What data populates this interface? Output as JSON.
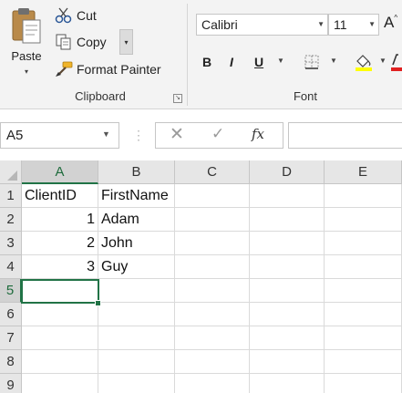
{
  "ribbon": {
    "clipboard": {
      "paste_label": "Paste",
      "cut_label": "Cut",
      "copy_label": "Copy",
      "format_painter_label": "Format Painter",
      "group_label": "Clipboard"
    },
    "font": {
      "font_name": "Calibri",
      "font_size": "11",
      "grow_font": "A",
      "bold": "B",
      "italic": "I",
      "underline": "U",
      "group_label": "Font"
    }
  },
  "formula_bar": {
    "name_box": "A5",
    "cancel_icon": "✕",
    "enter_icon": "✓",
    "function_label": "fx",
    "formula": ""
  },
  "grid": {
    "columns": [
      "A",
      "B",
      "C",
      "D",
      "E"
    ],
    "rows": [
      "1",
      "2",
      "3",
      "4",
      "5",
      "6",
      "7",
      "8",
      "9"
    ],
    "selected_cell": "A5",
    "cells": {
      "A1": "ClientID",
      "B1": "FirstName",
      "A2": "1",
      "B2": "Adam",
      "A3": "2",
      "B3": "John",
      "A4": "3",
      "B4": "Guy"
    }
  },
  "colors": {
    "accent": "#217346",
    "ribbon_bg": "#f3f3f3",
    "header_bg": "#e6e6e6",
    "gridline": "#dadada"
  }
}
